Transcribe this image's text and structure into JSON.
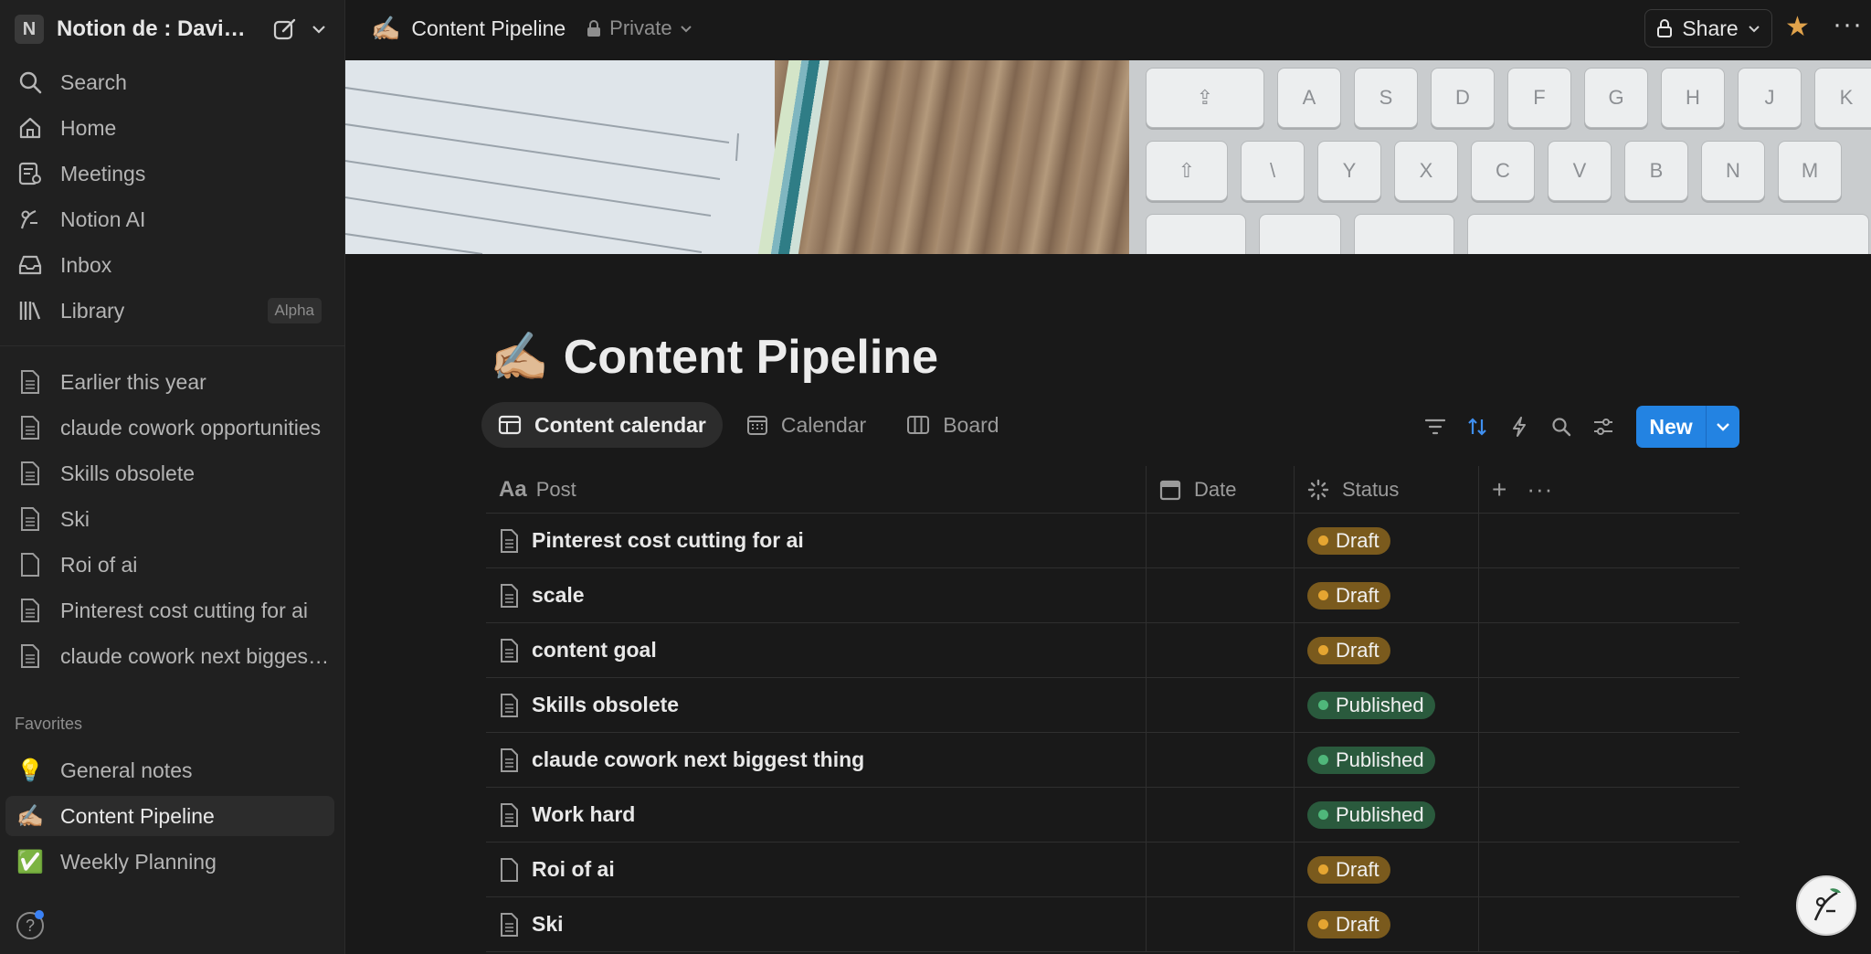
{
  "workspace": {
    "initial": "N",
    "name": "Notion de : David..."
  },
  "nav": [
    {
      "label": "Search",
      "icon": "search-icon"
    },
    {
      "label": "Home",
      "icon": "home-icon"
    },
    {
      "label": "Meetings",
      "icon": "meetings-icon"
    },
    {
      "label": "Notion AI",
      "icon": "notion-ai-icon"
    },
    {
      "label": "Inbox",
      "icon": "inbox-icon"
    },
    {
      "label": "Library",
      "icon": "library-icon",
      "badge": "Alpha"
    }
  ],
  "recent_pages": [
    "Earlier this year",
    "claude cowork opportunities",
    "Skills obsolete",
    "Ski",
    "Roi of ai",
    "Pinterest cost cutting for ai",
    "claude cowork next biggest thing"
  ],
  "favorites": {
    "header": "Favorites",
    "items": [
      {
        "emoji": "💡",
        "label": "General notes"
      },
      {
        "emoji": "✍🏼",
        "label": "Content Pipeline",
        "active": true
      },
      {
        "emoji": "✅",
        "label": "Weekly Planning"
      }
    ]
  },
  "topbar": {
    "emoji": "✍🏼",
    "title": "Content Pipeline",
    "privacy": "Private",
    "share_label": "Share"
  },
  "page": {
    "emoji": "✍🏼",
    "title": "Content Pipeline"
  },
  "views": [
    {
      "label": "Content calendar",
      "icon": "table-icon",
      "active": true
    },
    {
      "label": "Calendar",
      "icon": "calendar-icon"
    },
    {
      "label": "Board",
      "icon": "board-icon"
    }
  ],
  "new_button": {
    "label": "New"
  },
  "table": {
    "columns": {
      "post": "Post",
      "date": "Date",
      "status": "Status"
    },
    "rows": [
      {
        "post": "Pinterest cost cutting for ai",
        "date": "",
        "status": "Draft"
      },
      {
        "post": "scale",
        "date": "",
        "status": "Draft"
      },
      {
        "post": "content goal",
        "date": "",
        "status": "Draft"
      },
      {
        "post": "Skills obsolete",
        "date": "",
        "status": "Published"
      },
      {
        "post": "claude cowork next biggest thing",
        "date": "",
        "status": "Published"
      },
      {
        "post": "Work hard",
        "date": "",
        "status": "Published"
      },
      {
        "post": "Roi of ai",
        "date": "",
        "status": "Draft"
      },
      {
        "post": "Ski",
        "date": "",
        "status": "Draft"
      }
    ]
  },
  "colors": {
    "accent": "#2383e2",
    "draft_bg": "#7a5a1d",
    "draft_dot": "#e5a531",
    "published_bg": "#2a5a3d",
    "published_dot": "#4fb77a",
    "star": "#e0a24b"
  }
}
